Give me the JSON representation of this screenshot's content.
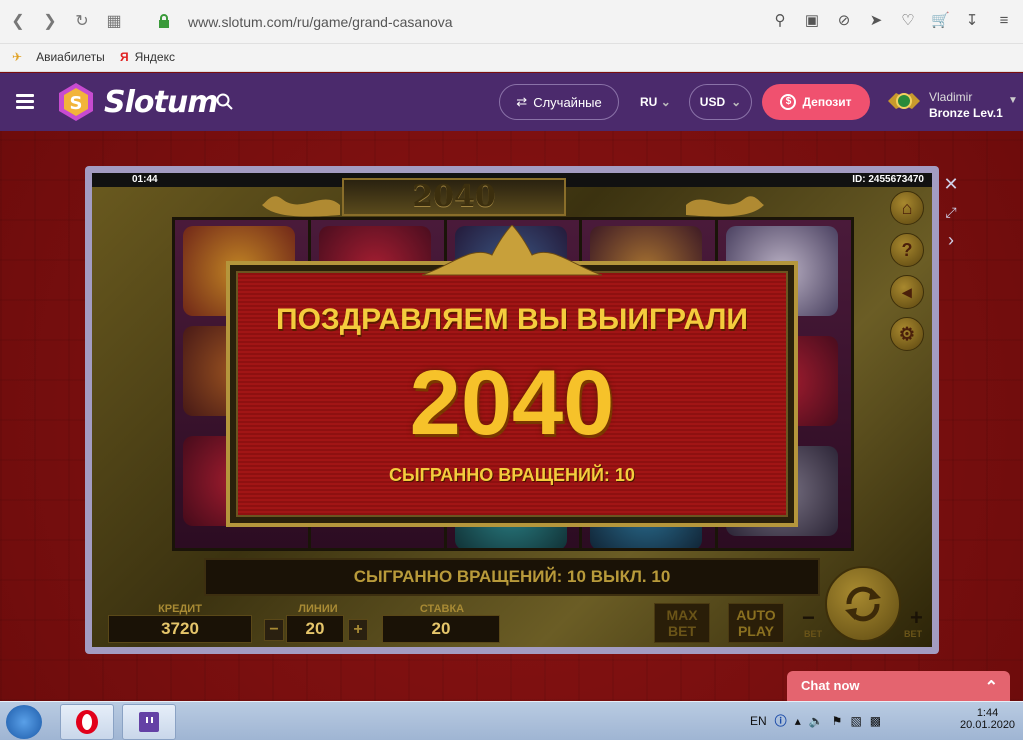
{
  "browser": {
    "url": "www.slotum.com/ru/game/grand-casanova",
    "bookmarks": [
      {
        "label": "Авиабилеты"
      },
      {
        "label": "Яндекс"
      }
    ]
  },
  "site": {
    "logo_text": "Slotum",
    "random_label": "Случайные",
    "language": "RU",
    "currency": "USD",
    "deposit_label": "Депозит",
    "user_name": "Vladimir",
    "user_level": "Bronze Lev.1"
  },
  "game": {
    "clock": "01:44",
    "game_id": "ID: 2455673470",
    "title_total": "2040",
    "win_title": "ПОЗДРАВЛЯЕМ ВЫ ВЫИГРАЛИ",
    "win_amount": "2040",
    "win_spins": "СЫГРАННО ВРАЩЕНИЙ: 10",
    "info_bar": "СЫГРАННО ВРАЩЕНИЙ: 10 ВЫКЛ. 10",
    "credit_label": "КРЕДИТ",
    "credit_value": "3720",
    "lines_label": "ЛИНИИ",
    "lines_value": "20",
    "bet_label": "СТАВКА",
    "bet_value": "20",
    "max_bet_label": "MAX BET",
    "auto_play_label": "AUTO PLAY",
    "bet_small": "BET"
  },
  "chat": {
    "label": "Chat now"
  },
  "taskbar": {
    "lang": "EN",
    "time": "1:44",
    "date": "20.01.2020"
  },
  "colors": {
    "header": "#4b2a6c",
    "deposit": "#f0516f",
    "win_gold": "#f4cc3d"
  }
}
